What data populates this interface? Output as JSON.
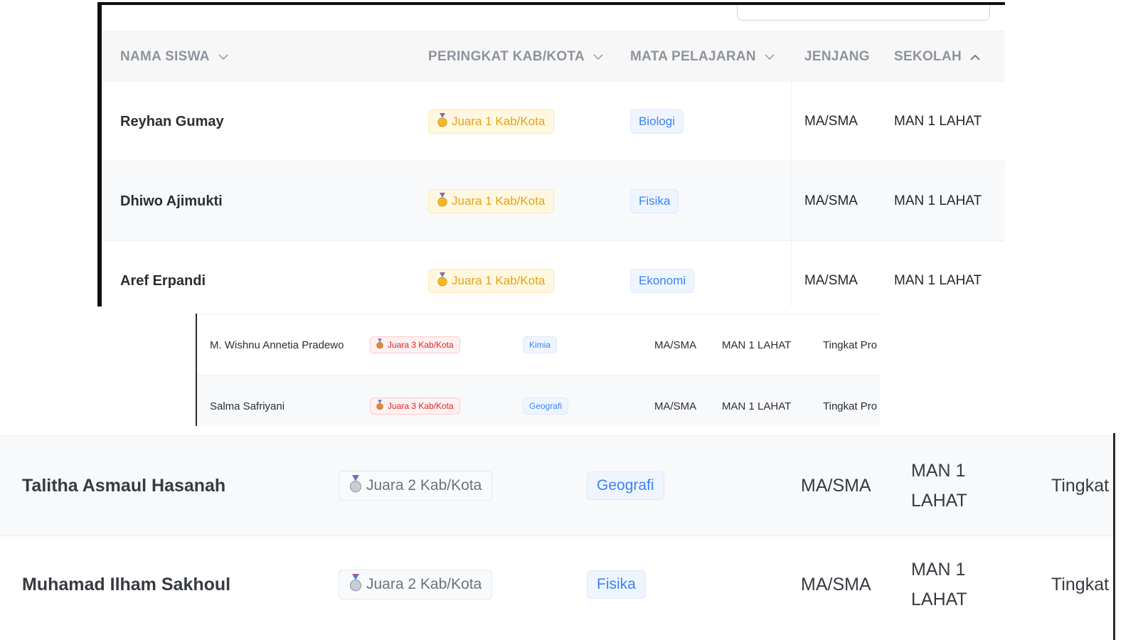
{
  "table_header": {
    "columns": [
      {
        "label": "NAMA SISWA",
        "sort": "chevron-down"
      },
      {
        "label": "PERINGKAT KAB/KOTA",
        "sort": "chevron-down"
      },
      {
        "label": "MATA PELAJARAN",
        "sort": "chevron-down"
      },
      {
        "label": "JENJANG",
        "sort": "none"
      },
      {
        "label": "SEKOLAH",
        "sort": "chevron-up"
      }
    ]
  },
  "top_rows": [
    {
      "name": "Reyhan Gumay",
      "rank": "Juara 1 Kab/Kota",
      "rank_medal": "gold-medal-icon",
      "subject": "Biologi",
      "level": "MA/SMA",
      "school": "MAN 1 LAHAT"
    },
    {
      "name": "Dhiwo Ajimukti",
      "rank": "Juara 1 Kab/Kota",
      "rank_medal": "gold-medal-icon",
      "subject": "Fisika",
      "level": "MA/SMA",
      "school": "MAN 1 LAHAT"
    },
    {
      "name": "Aref Erpandi",
      "rank": "Juara 1 Kab/Kota",
      "rank_medal": "gold-medal-icon",
      "subject": "Ekonomi",
      "level": "MA/SMA",
      "school": "MAN 1 LAHAT"
    }
  ],
  "middle_rows": [
    {
      "name": "M. Wishnu Annetia Pradewo",
      "rank": "Juara 3 Kab/Kota",
      "rank_medal": "bronze-medal-icon",
      "subject": "Kimia",
      "level": "MA/SMA",
      "school": "MAN 1 LAHAT",
      "next_level": "Tingkat Pro"
    },
    {
      "name": "Salma Safriyani",
      "rank": "Juara 3 Kab/Kota",
      "rank_medal": "bronze-medal-icon",
      "subject": "Geografi",
      "level": "MA/SMA",
      "school": "MAN 1 LAHAT",
      "next_level": "Tingkat Pro"
    }
  ],
  "bottom_rows": [
    {
      "name": "Talitha Asmaul Hasanah",
      "rank": "Juara 2 Kab/Kota",
      "rank_medal": "silver-medal-icon",
      "subject": "Geografi",
      "level": "MA/SMA",
      "school": "MAN 1 LAHAT",
      "next_level": "Tingkat"
    },
    {
      "name": "Muhamad Ilham Sakhoul",
      "rank": "Juara 2 Kab/Kota",
      "rank_medal": "silver-medal-icon",
      "subject": "Fisika",
      "level": "MA/SMA",
      "school": "MAN 1 LAHAT",
      "next_level": "Tingkat"
    }
  ],
  "colors": {
    "gold": "#e5a318",
    "bronze": "#dc2626",
    "silver": "#6b7280",
    "subject": "#3b82f6",
    "header_text": "#8e949c"
  }
}
